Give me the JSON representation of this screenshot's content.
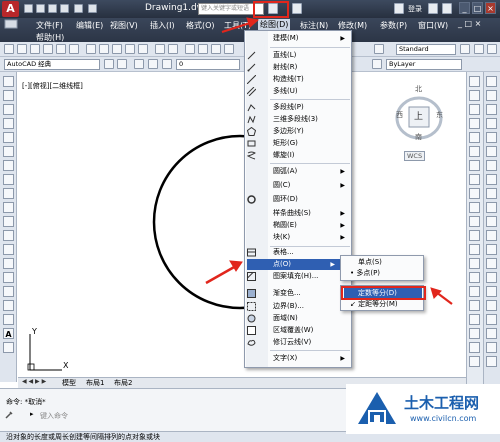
{
  "app": {
    "title": "Drawing1.dwg",
    "search_placeholder": "键入关键字或短语",
    "login_label": "登录",
    "logo_letter": "A"
  },
  "menubar": {
    "items": [
      "文件(F)",
      "编辑(E)",
      "视图(V)",
      "插入(I)",
      "格式(O)",
      "工具(T)",
      "绘图(D)",
      "标注(N)",
      "修改(M)",
      "参数(P)",
      "窗口(W)",
      "帮助(H)"
    ]
  },
  "toolbar": {
    "workspace": "AutoCAD 经典",
    "layer_value": "0",
    "style_value": "Standard",
    "bylayer_value": "ByLayer"
  },
  "viewport": {
    "label": "[-][俯视][二维线框]"
  },
  "viewcube": {
    "north": "北",
    "west": "西",
    "east": "东",
    "south": "南",
    "top": "上",
    "wcs": "WCS"
  },
  "draw_menu": {
    "items": [
      {
        "label": "建模(M)",
        "arrow": "▶"
      },
      {
        "label": "直线(L)"
      },
      {
        "label": "射线(R)"
      },
      {
        "label": "构造线(T)"
      },
      {
        "label": "多线(U)"
      },
      {
        "label": "多段线(P)"
      },
      {
        "label": "三维多段线(3)"
      },
      {
        "label": "多边形(Y)"
      },
      {
        "label": "矩形(G)"
      },
      {
        "label": "螺旋(I)"
      },
      {
        "label": "圆弧(A)",
        "arrow": "▶"
      },
      {
        "label": "圆(C)",
        "arrow": "▶"
      },
      {
        "label": "圆环(D)"
      },
      {
        "label": "样条曲线(S)",
        "arrow": "▶"
      },
      {
        "label": "椭圆(E)",
        "arrow": "▶"
      },
      {
        "label": "块(K)",
        "arrow": "▶"
      },
      {
        "label": "表格..."
      },
      {
        "label": "点(O)",
        "arrow": "▶"
      },
      {
        "label": "图案填充(H)..."
      },
      {
        "label": "渐变色..."
      },
      {
        "label": "边界(B)..."
      },
      {
        "label": "面域(N)"
      },
      {
        "label": "区域覆盖(W)"
      },
      {
        "label": "修订云线(V)"
      },
      {
        "label": "文字(X)",
        "arrow": "▶"
      }
    ]
  },
  "point_submenu": {
    "items": [
      "单点(S)",
      "多点(P)",
      "定数等分(D)",
      "定距等分(M)"
    ]
  },
  "layout_tabs": [
    "模型",
    "布局1",
    "布局2"
  ],
  "command": {
    "history": "命令:  *取消*",
    "prompt_placeholder": "键入命令",
    "status": "沿对象的长度或周长创建等间隔排列的点对象或块"
  },
  "watermark": {
    "brand": "土木工程网",
    "url": "www.civilcn.com"
  },
  "colors": {
    "title_bg": "#2c3546",
    "highlight": "#2f5fb2",
    "annotation_red": "#e1261c",
    "watermark_blue": "#1b5fae"
  }
}
